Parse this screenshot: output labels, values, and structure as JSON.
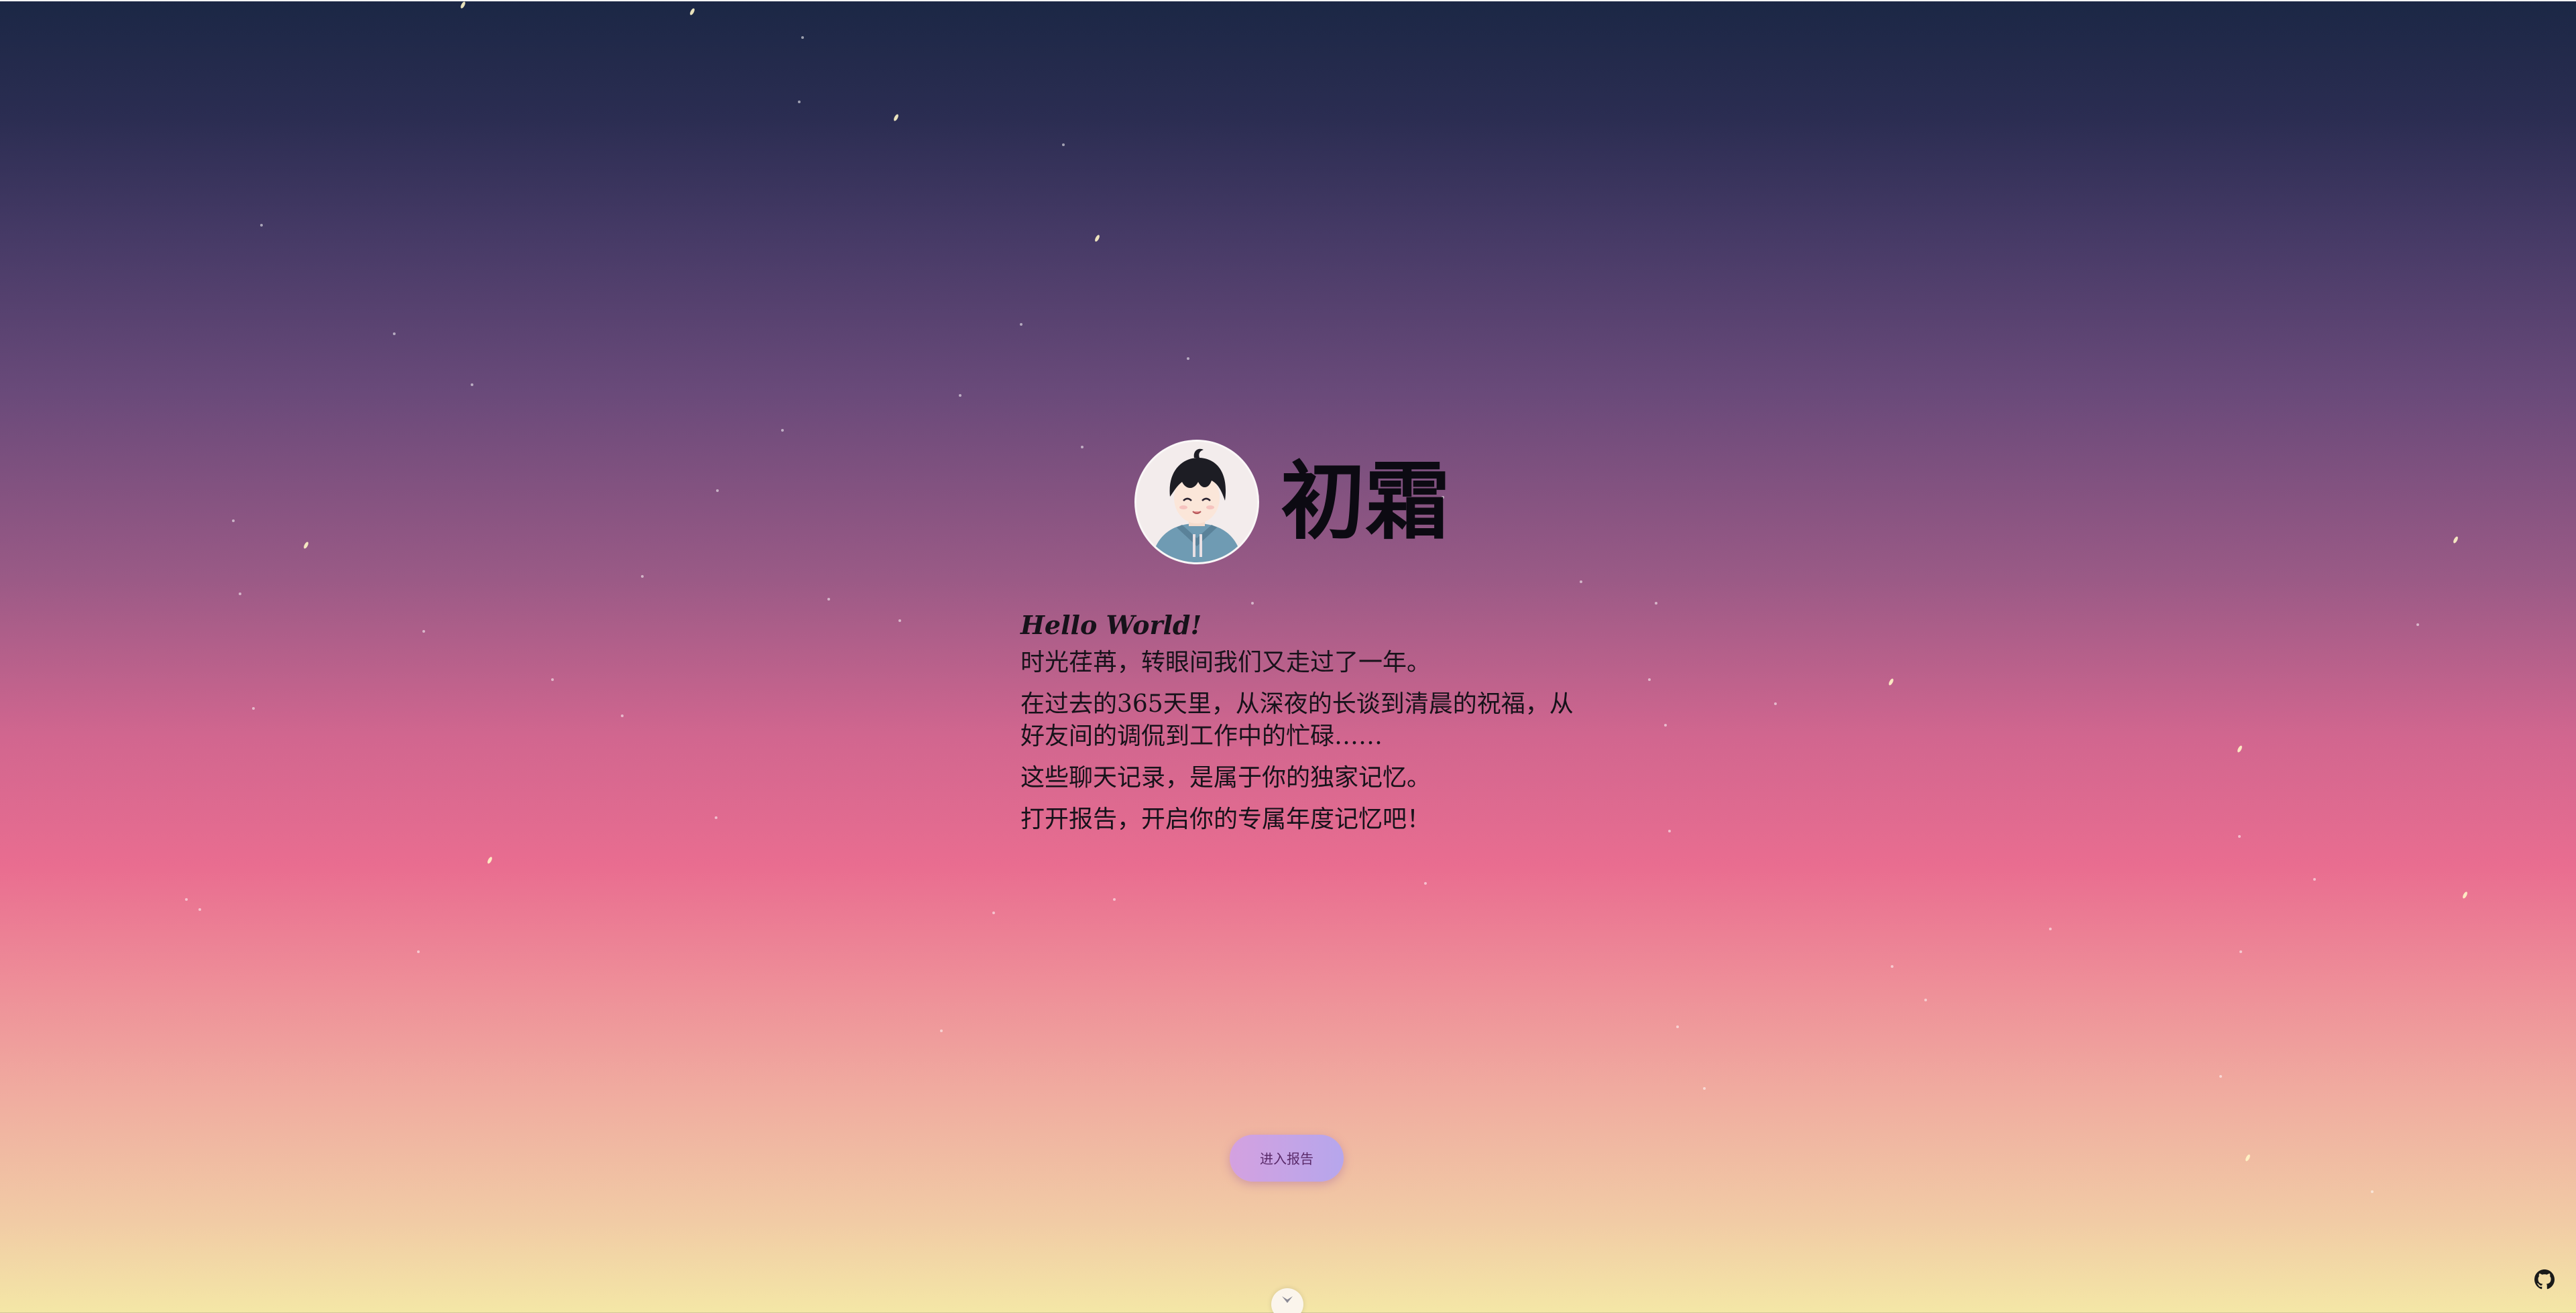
{
  "profile": {
    "name": "初霜",
    "avatar_icon": "anime-boy-avatar"
  },
  "intro": {
    "greeting": "Hello World!",
    "lines": [
      "时光荏苒，转眼间我们又走过了一年。",
      "在过去的365天里，从深夜的长谈到清晨的祝福，从好友间的调侃到工作中的忙碌……",
      "这些聊天记录，是属于你的独家记忆。",
      "打开报告，开启你的专属年度记忆吧！"
    ]
  },
  "actions": {
    "enter_label": "进入报告"
  },
  "icons": {
    "scroll": "chevron-down-icon",
    "github": "github-icon"
  },
  "colors": {
    "sky_top": "#1b2745",
    "sky_mid": "#e96d90",
    "sky_bottom": "#f4e7a6",
    "button": "#c9a3e6"
  }
}
